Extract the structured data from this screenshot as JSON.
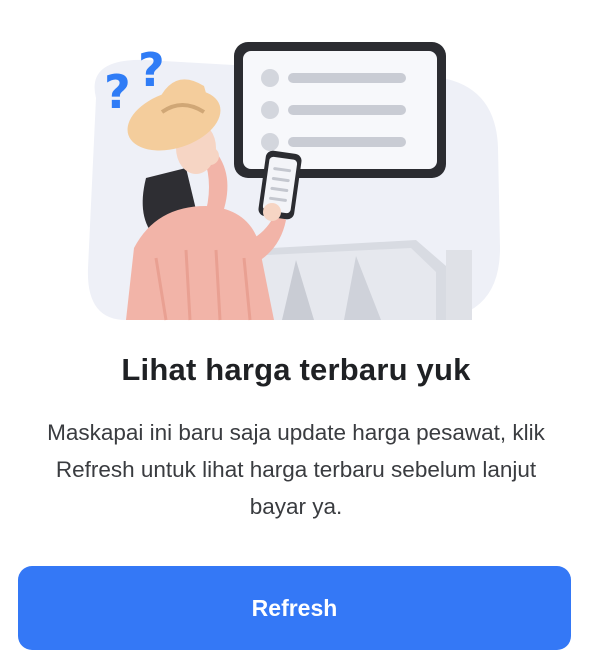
{
  "dialog": {
    "title": "Lihat harga terbaru yuk",
    "description": "Maskapai ini baru saja update harga pesawat, klik Refresh untuk lihat harga terbaru sebelum lanjut bayar ya.",
    "refresh_label": "Refresh"
  },
  "illustration": {
    "icon": "confused-traveler-checking-price-illustration",
    "question_mark": "?"
  },
  "colors": {
    "accent": "#3478f6",
    "question_marks": "#2f7cf6",
    "background_blob": "#eef0f7"
  }
}
